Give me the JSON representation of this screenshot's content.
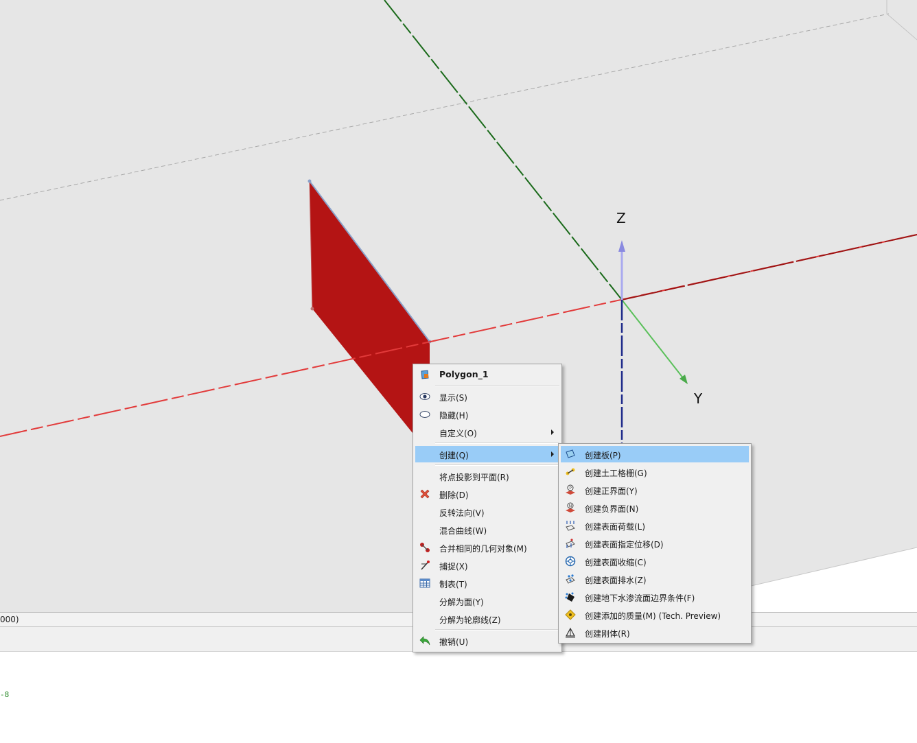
{
  "viewport": {
    "axis_labels": {
      "z": "Z",
      "y": "Y"
    },
    "polygon_color": "#b41414"
  },
  "status": {
    "coord_text": "000)"
  },
  "console": {
    "line": "-8"
  },
  "context_menu": {
    "header": {
      "label": "Polygon_1",
      "icon": "polygon-object-icon"
    },
    "items": [
      {
        "label": "显示(S)",
        "icon": "eye-icon"
      },
      {
        "label": "隐藏(H)",
        "icon": "eye-closed-icon"
      },
      {
        "label": "自定义(O)",
        "submenu": true
      },
      {
        "label": "创建(Q)",
        "submenu": true,
        "highlighted": true
      },
      {
        "label": "将点投影到平面(R)"
      },
      {
        "label": "删除(D)",
        "icon": "delete-icon"
      },
      {
        "label": "反转法向(V)"
      },
      {
        "label": "混合曲线(W)"
      },
      {
        "label": "合并相同的几何对象(M)",
        "icon": "merge-icon"
      },
      {
        "label": "捕捉(X)",
        "icon": "snap-icon"
      },
      {
        "label": "制表(T)",
        "icon": "table-icon"
      },
      {
        "label": "分解为面(Y)"
      },
      {
        "label": "分解为轮廓线(Z)"
      },
      {
        "label": "撤销(U)",
        "icon": "undo-icon"
      }
    ]
  },
  "submenu": {
    "items": [
      {
        "label": "创建板(P)",
        "icon": "plate-icon",
        "highlighted": true
      },
      {
        "label": "创建土工格栅(G)",
        "icon": "geogrid-icon"
      },
      {
        "label": "创建正界面(Y)",
        "icon": "positive-interface-icon"
      },
      {
        "label": "创建负界面(N)",
        "icon": "negative-interface-icon"
      },
      {
        "label": "创建表面荷载(L)",
        "icon": "surface-load-icon"
      },
      {
        "label": "创建表面指定位移(D)",
        "icon": "surface-displacement-icon"
      },
      {
        "label": "创建表面收缩(C)",
        "icon": "surface-contraction-icon"
      },
      {
        "label": "创建表面排水(Z)",
        "icon": "surface-drain-icon"
      },
      {
        "label": "创建地下水渗流面边界条件(F)",
        "icon": "groundwater-flow-icon"
      },
      {
        "label": "创建添加的质量(M) (Tech. Preview)",
        "icon": "added-mass-icon"
      },
      {
        "label": "创建刚体(R)",
        "icon": "rigid-body-icon"
      }
    ]
  }
}
